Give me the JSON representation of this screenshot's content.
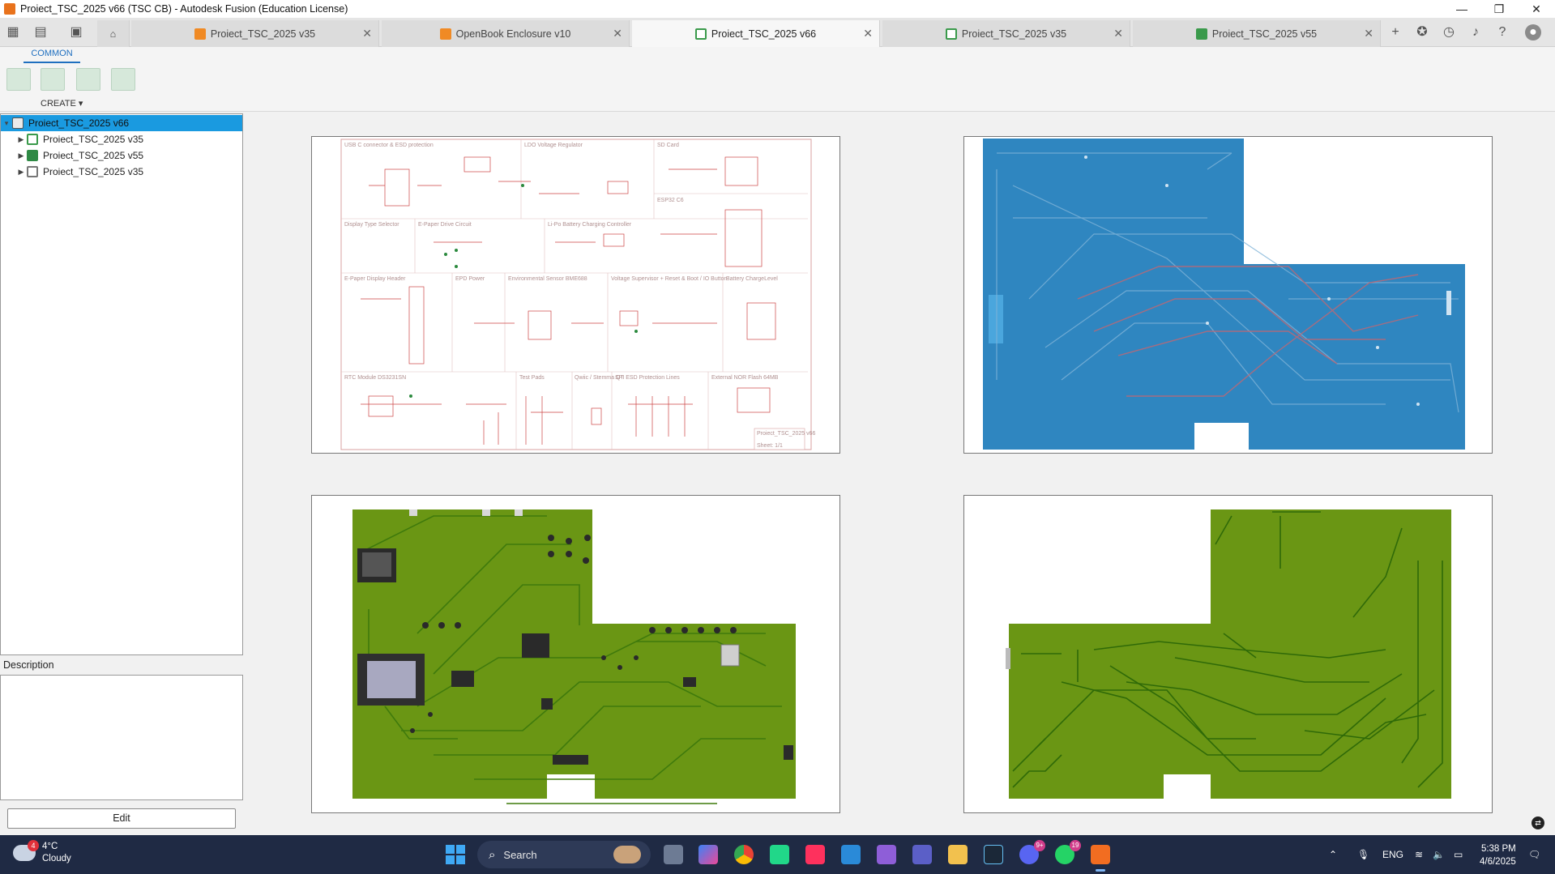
{
  "window": {
    "title": "Proiect_TSC_2025 v66 (TSC CB) - Autodesk Fusion (Education License)",
    "buttons": [
      "—",
      "❐",
      "✕"
    ]
  },
  "tabs": [
    {
      "label": "Proiect_TSC_2025 v35",
      "icon": "design-box-icon",
      "active": false
    },
    {
      "label": "OpenBook Enclosure v10",
      "icon": "design-box-icon",
      "active": false
    },
    {
      "label": "Proiect_TSC_2025 v66",
      "icon": "schematic-icon",
      "active": true
    },
    {
      "label": "Proiect_TSC_2025 v35",
      "icon": "schematic-icon",
      "active": false
    },
    {
      "label": "Proiect_TSC_2025 v55",
      "icon": "pcb-icon",
      "active": false
    }
  ],
  "toolbar": {
    "common_tab": "COMMON",
    "create_label": "CREATE ▾"
  },
  "tree": {
    "root": "Proiect_TSC_2025 v66",
    "children": [
      {
        "label": "Proiect_TSC_2025 v35",
        "icon": "schematic-icon"
      },
      {
        "label": "Proiect_TSC_2025 v55",
        "icon": "pcb-icon"
      },
      {
        "label": "Proiect_TSC_2025 v35",
        "icon": "board-icon"
      }
    ]
  },
  "description": {
    "label": "Description",
    "edit_button": "Edit"
  },
  "schematic": {
    "sections": [
      "USB C connector & ESD protection",
      "LDO Voltage Regulator",
      "SD Card",
      "ESP32 C6",
      "Display Type Selector",
      "E-Paper Drive Circuit",
      "Li-Po Battery Charging Controller",
      "E-Paper Display Header",
      "EPD Power",
      "Environmental Sensor BME688",
      "Voltage Supervisor + Reset & Boot / IO Button",
      "Battery ChargeLevel",
      "RTC Module DS3231SN",
      "Test Pads",
      "Qwiic / Stemma QT",
      "SPI ESD Protection Lines",
      "External NOR Flash 64MB"
    ],
    "title_block": [
      "Proiect_TSC_2025 v66",
      "Sheet: 1/1"
    ]
  },
  "taskbar": {
    "weather_temp": "4°C",
    "weather_desc": "Cloudy",
    "weather_badge": "4",
    "search_placeholder": "Search",
    "discord_badge": "9+",
    "whatsapp_badge": "19",
    "lang": "ENG",
    "time": "5:38 PM",
    "date": "4/6/2025"
  },
  "colors": {
    "selection": "#1a9ae0",
    "pcb_green": "#6a9614",
    "pcb_blue": "#2f86c0",
    "accent": "#1f6fbf"
  }
}
